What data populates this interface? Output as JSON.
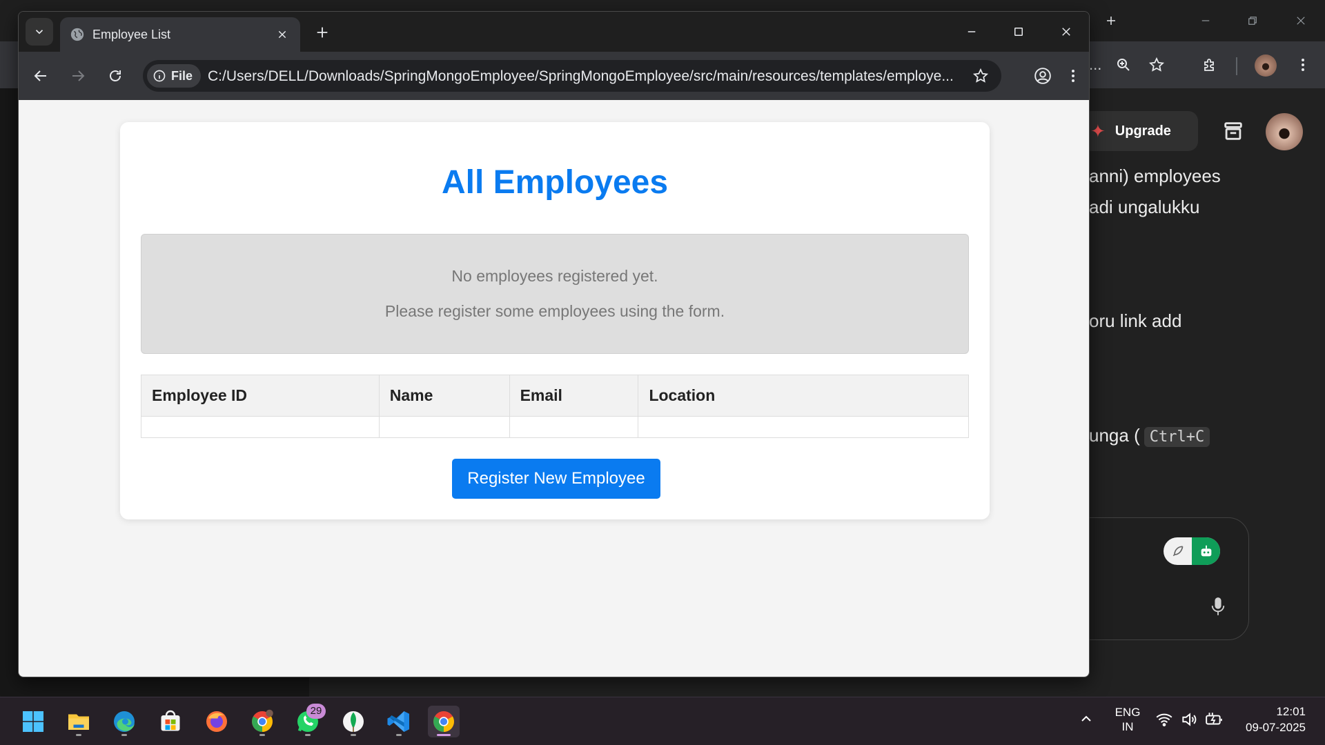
{
  "browser": {
    "tab_title": "Employee List",
    "site_chip": "File",
    "url": "C:/Users/DELL/Downloads/SpringMongoEmployee/SpringMongoEmployee/src/main/resources/templates/employe..."
  },
  "page": {
    "title": "All Employees",
    "empty_message": "No employees registered yet.",
    "empty_hint": "Please register some employees using the form.",
    "table_headers": [
      "Employee ID",
      "Name",
      "Email",
      "Location"
    ],
    "register_button": "Register New Employee"
  },
  "background_app": {
    "url_tail": "...",
    "upgrade_label": "Upgrade",
    "chat_lines": [
      "anni) employees",
      "adi ungalukku",
      "oru link add",
      "unga ("
    ],
    "kbd": "Ctrl+C"
  },
  "taskbar": {
    "whatsapp_badge": "29",
    "lang": [
      "ENG",
      "IN"
    ],
    "time": "12:01",
    "date": "09-07-2025"
  },
  "colors": {
    "accent": "#0a7bf0",
    "empty_box": "#dedede",
    "chrome_dark": "#1f1f1f",
    "chrome_toolbar": "#35363a"
  }
}
